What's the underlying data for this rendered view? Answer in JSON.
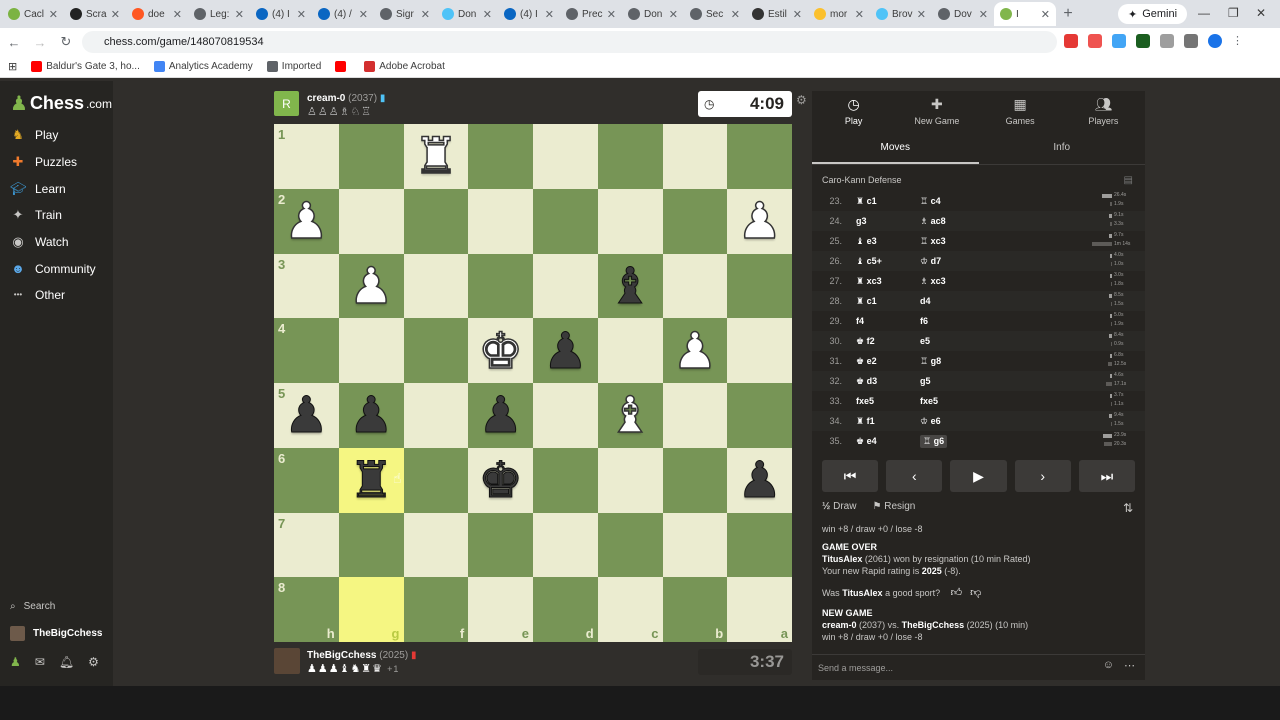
{
  "browser": {
    "tabs": [
      {
        "label": "Cacl",
        "color": "#7cb342"
      },
      {
        "label": "Scra",
        "color": "#222222"
      },
      {
        "label": "doe",
        "color": "#ff5722"
      },
      {
        "label": "Leg:",
        "color": "#5f6368"
      },
      {
        "label": "(4) I",
        "color": "#0a66c2"
      },
      {
        "label": "(4) /",
        "color": "#0a66c2"
      },
      {
        "label": "Sigr",
        "color": "#5f6368"
      },
      {
        "label": "Don",
        "color": "#4fc3f7"
      },
      {
        "label": "(4) I",
        "color": "#0a66c2"
      },
      {
        "label": "Prec",
        "color": "#5f6368"
      },
      {
        "label": "Don",
        "color": "#5f6368"
      },
      {
        "label": "Sec",
        "color": "#5f6368"
      },
      {
        "label": "Estil",
        "color": "#333333"
      },
      {
        "label": "mor",
        "color": "#fbc02d"
      },
      {
        "label": "Brov",
        "color": "#4fc3f7"
      },
      {
        "label": "Dov",
        "color": "#5f6368"
      },
      {
        "label": "I",
        "color": "#81b64c"
      }
    ],
    "gemini_label": "Gemini",
    "url": "chess.com/game/148070819534",
    "bookmarks": [
      {
        "label": "Baldur's Gate 3, ho...",
        "color": "#ff0000"
      },
      {
        "label": "Analytics Academy",
        "color": "#4285f4"
      },
      {
        "label": "Imported",
        "color": "#5f6368"
      },
      {
        "label": "",
        "color": "#ff0000"
      },
      {
        "label": "Adobe Acrobat",
        "color": "#d32f2f"
      }
    ]
  },
  "sidebar": {
    "logo_main": "Chess",
    "logo_suffix": ".com",
    "items": [
      {
        "label": "Play",
        "icon": "play-icon"
      },
      {
        "label": "Puzzles",
        "icon": "puzzle-icon"
      },
      {
        "label": "Learn",
        "icon": "learn-icon"
      },
      {
        "label": "Train",
        "icon": "train-icon"
      },
      {
        "label": "Watch",
        "icon": "watch-icon"
      },
      {
        "label": "Community",
        "icon": "community-icon"
      },
      {
        "label": "Other",
        "icon": "more-icon"
      }
    ],
    "search_label": "Search",
    "username": "TheBigCchess"
  },
  "top_player": {
    "avatar_letter": "R",
    "name": "cream-0",
    "rating": "(2037)",
    "captured": "♙♙♙♗♘♖",
    "clock": "4:09"
  },
  "bottom_player": {
    "name": "TheBigCchess",
    "rating": "(2025)",
    "captured": "♟♟♟♝♞♜♛",
    "captured_extra": "+1",
    "clock": "3:37"
  },
  "board": {
    "ranks": [
      "1",
      "2",
      "3",
      "4",
      "5",
      "6",
      "7",
      "8"
    ],
    "files": [
      "h",
      "g",
      "f",
      "e",
      "d",
      "c",
      "b",
      "a"
    ],
    "pieces": [
      [
        "",
        "",
        "wR",
        "",
        "",
        "",
        "",
        ""
      ],
      [
        "wP",
        "",
        "",
        "",
        "",
        "",
        "",
        "wP"
      ],
      [
        "",
        "wP",
        "",
        "",
        "",
        "bB",
        "",
        ""
      ],
      [
        "",
        "",
        "",
        "wK",
        "bP",
        "",
        "wP",
        ""
      ],
      [
        "bP",
        "bP",
        "",
        "bP",
        "",
        "wB",
        "",
        ""
      ],
      [
        "",
        "bR",
        "",
        "bK",
        "",
        "",
        "",
        "bP"
      ],
      [
        "",
        "",
        "",
        "",
        "",
        "",
        "",
        ""
      ],
      [
        "",
        "",
        "",
        "",
        "",
        "",
        "",
        ""
      ]
    ],
    "highlights": [
      "5-1",
      "7-1"
    ]
  },
  "panel": {
    "tabs": [
      {
        "label": "Play",
        "icon": "stopwatch-icon"
      },
      {
        "label": "New Game",
        "icon": "plus-icon"
      },
      {
        "label": "Games",
        "icon": "games-icon"
      },
      {
        "label": "Players",
        "icon": "players-icon"
      }
    ],
    "subtabs": [
      "Moves",
      "Info"
    ],
    "opening": "Caro-Kann Defense",
    "moves": [
      {
        "n": "23.",
        "w": "♜ c1",
        "b": "♖ c4",
        "tw": "26.4s",
        "tb": "1.9s",
        "ww": 10,
        "wb": 2
      },
      {
        "n": "24.",
        "w": "g3",
        "b": "♗ ac8",
        "tw": "9.1s",
        "tb": "3.3s",
        "ww": 3,
        "wb": 2
      },
      {
        "n": "25.",
        "w": "♝ e3",
        "b": "♖ xc3",
        "tw": "9.7s",
        "tb": "1m 14s",
        "ww": 3,
        "wb": 20
      },
      {
        "n": "26.",
        "w": "♝ c5+",
        "b": "♔ d7",
        "tw": "4.0s",
        "tb": "1.0s",
        "ww": 2,
        "wb": 1
      },
      {
        "n": "27.",
        "w": "♜ xc3",
        "b": "♗ xc3",
        "tw": "3.0s",
        "tb": "1.8s",
        "ww": 2,
        "wb": 1
      },
      {
        "n": "28.",
        "w": "♜ c1",
        "b": "d4",
        "tw": "8.5s",
        "tb": "1.5s",
        "ww": 3,
        "wb": 1
      },
      {
        "n": "29.",
        "w": "f4",
        "b": "f6",
        "tw": "5.0s",
        "tb": "1.9s",
        "ww": 2,
        "wb": 1
      },
      {
        "n": "30.",
        "w": "♚ f2",
        "b": "e5",
        "tw": "8.4s",
        "tb": "0.9s",
        "ww": 3,
        "wb": 1
      },
      {
        "n": "31.",
        "w": "♚ e2",
        "b": "♖ g8",
        "tw": "6.8s",
        "tb": "12.5s",
        "ww": 2,
        "wb": 4
      },
      {
        "n": "32.",
        "w": "♚ d3",
        "b": "g5",
        "tw": "4.6s",
        "tb": "17.1s",
        "ww": 2,
        "wb": 6
      },
      {
        "n": "33.",
        "w": "fxe5",
        "b": "fxe5",
        "tw": "3.7s",
        "tb": "1.1s",
        "ww": 2,
        "wb": 1
      },
      {
        "n": "34.",
        "w": "♜ f1",
        "b": "♔ e6",
        "tw": "9.4s",
        "tb": "1.5s",
        "ww": 3,
        "wb": 1
      },
      {
        "n": "35.",
        "w": "♚ e4",
        "b": "♖ g6",
        "tw": "23.9s",
        "tb": "20.3s",
        "ww": 9,
        "wb": 8
      }
    ],
    "draw_label": "Draw",
    "draw_icon": "½",
    "resign_label": "Resign",
    "log": {
      "line1": "win +8 / draw +0 / lose -8",
      "game_over": "GAME OVER",
      "winner": "TitusAlex",
      "winner_text": "(2061) won by resignation (10 min Rated)",
      "rating_text": "Your new Rapid rating is",
      "rating_value": "2025",
      "rating_change": "(-8).",
      "sport_q1": "Was",
      "sport_name": "TitusAlex",
      "sport_q2": "a good sport?",
      "new_game": "NEW GAME",
      "ng_p1": "cream-0",
      "ng_mid": "(2037) vs.",
      "ng_p2": "TheBigCchess",
      "ng_tail": "(2025) (10 min)",
      "line_last": "win +8 / draw +0 / lose -8"
    },
    "message_placeholder": "Send a message..."
  }
}
